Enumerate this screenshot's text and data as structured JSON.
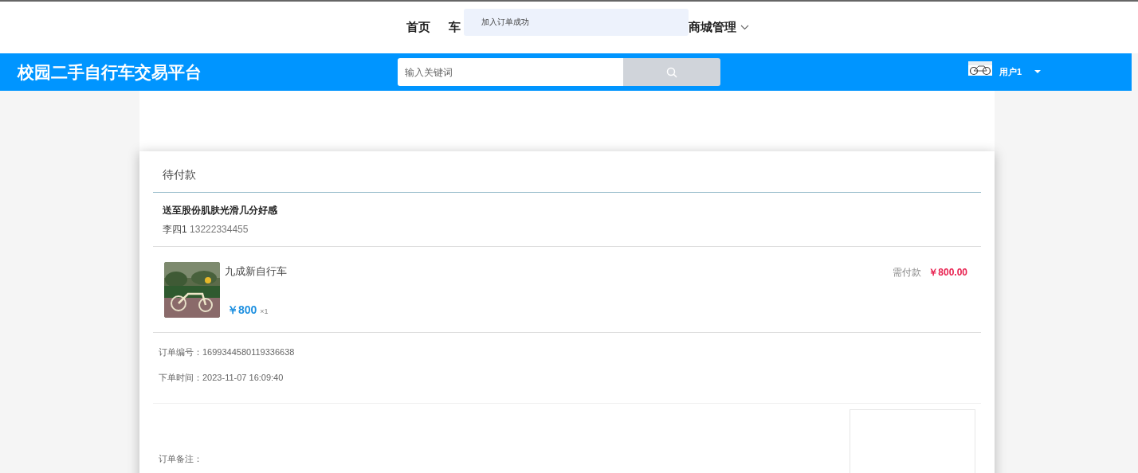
{
  "nav": [
    {
      "label": "首页",
      "dropdown": false
    },
    {
      "label": "车",
      "dropdown": false
    },
    {
      "label": "商城管理",
      "dropdown": true
    }
  ],
  "toast": {
    "message": "加入订单成功"
  },
  "header": {
    "site_title": "校园二手自行车交易平台",
    "search": {
      "placeholder": "输入关键词"
    },
    "user": {
      "name": "用户1"
    }
  },
  "order": {
    "status": "待付款",
    "address": {
      "line": "送至股份肌肤光滑几分好感",
      "contact_name": "李四1",
      "phone": "13222334455"
    },
    "items": [
      {
        "name": "九成新自行车",
        "price": "￥800",
        "quantity": "×1",
        "due_label": "需付款",
        "due_amount": "￥800.00"
      }
    ],
    "order_number": "订单编号：1699344580119336638",
    "order_time": "下单时间：2023-11-07 16:09:40",
    "remark_label": "订单备注："
  }
}
